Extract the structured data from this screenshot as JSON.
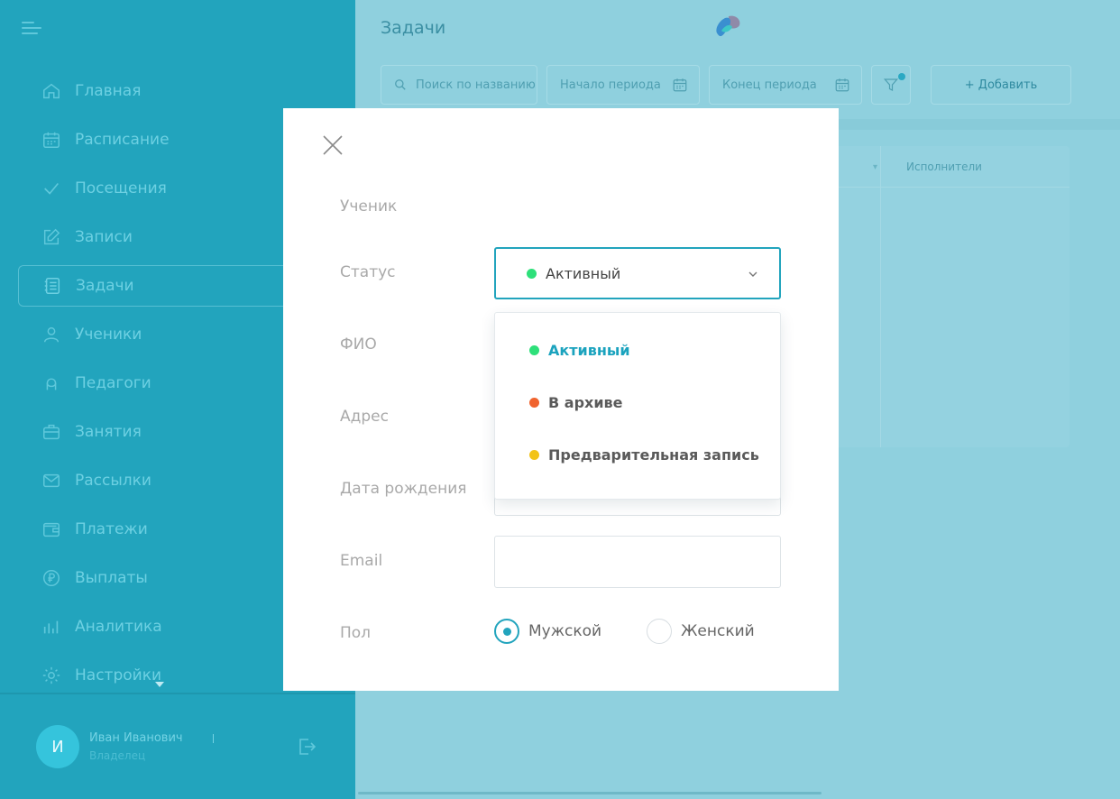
{
  "sidebar": {
    "items": [
      {
        "label": "Главная",
        "icon": "home-icon"
      },
      {
        "label": "Расписание",
        "icon": "calendar-icon"
      },
      {
        "label": "Посещения",
        "icon": "check-icon"
      },
      {
        "label": "Записи",
        "icon": "edit-icon"
      },
      {
        "label": "Задачи",
        "icon": "tasks-icon",
        "active": true
      },
      {
        "label": "Ученики",
        "icon": "user-icon"
      },
      {
        "label": "Педагоги",
        "icon": "teacher-icon"
      },
      {
        "label": "Занятия",
        "icon": "briefcase-icon"
      },
      {
        "label": "Рассылки",
        "icon": "mail-icon"
      },
      {
        "label": "Платежи",
        "icon": "wallet-icon"
      },
      {
        "label": "Выплаты",
        "icon": "ruble-icon"
      },
      {
        "label": "Аналитика",
        "icon": "chart-icon"
      },
      {
        "label": "Настройки",
        "icon": "gear-icon"
      }
    ],
    "user": {
      "initial": "И",
      "name": "Иван Иванович",
      "role": "Владелец"
    }
  },
  "header": {
    "title": "Задачи",
    "search_placeholder": "Поиск по названию",
    "start_period": "Начало периода",
    "end_period": "Конец периода",
    "add_label": "+ Добавить"
  },
  "table": {
    "column": "Исполнители"
  },
  "modal": {
    "labels": {
      "student": "Ученик",
      "status": "Статус",
      "fio": "ФИО",
      "address": "Адрес",
      "birthdate": "Дата рождения",
      "email": "Email",
      "gender": "Пол"
    },
    "status_selected": "Активный",
    "status_options": [
      {
        "label": "Активный",
        "color": "#2ee07a"
      },
      {
        "label": "В архиве",
        "color": "#f0632e"
      },
      {
        "label": "Предварительная запись",
        "color": "#f2c318"
      }
    ],
    "gender_options": [
      "Мужской",
      "Женский"
    ]
  },
  "colors": {
    "accent": "#22a4bd",
    "sidebar": "#22a4bd",
    "overlay": "#8fd0de"
  }
}
